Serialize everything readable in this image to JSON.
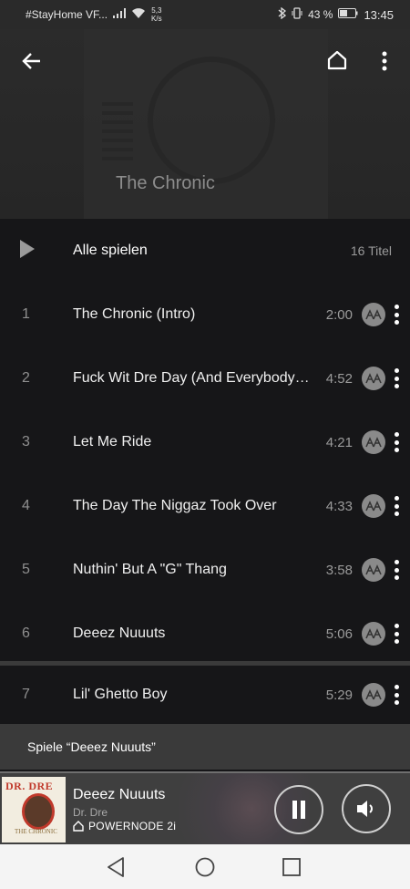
{
  "status_bar": {
    "carrier": "#StayHome VF...",
    "speed_value": "5,3",
    "speed_unit": "K/s",
    "battery": "43 %",
    "time": "13:45"
  },
  "header": {
    "album_title": "The Chronic",
    "icons": [
      "back-arrow-icon",
      "home-icon",
      "more-vert-icon"
    ]
  },
  "play_all": {
    "label": "Alle spielen",
    "count": "16 Titel"
  },
  "tracks": [
    {
      "num": "1",
      "title": "The Chronic (Intro)",
      "duration": "2:00"
    },
    {
      "num": "2",
      "title": "Fuck Wit Dre Day (And Everybody's...",
      "duration": "4:52"
    },
    {
      "num": "3",
      "title": "Let Me Ride",
      "duration": "4:21"
    },
    {
      "num": "4",
      "title": "The Day The Niggaz Took Over",
      "duration": "4:33"
    },
    {
      "num": "5",
      "title": "Nuthin' But A \"G\" Thang",
      "duration": "3:58"
    },
    {
      "num": "6",
      "title": "Deeez Nuuuts",
      "duration": "5:06"
    },
    {
      "num": "7",
      "title": "Lil' Ghetto Boy",
      "duration": "5:29"
    }
  ],
  "toast": {
    "text": "Spiele “Deeez Nuuuts”"
  },
  "now_playing": {
    "title": "Deeez Nuuuts",
    "artist": "Dr. Dre",
    "device": "POWERNODE 2i",
    "art_logo": "DR. DRE",
    "art_subtitle": "THE CHRONIC",
    "icons": [
      "pause-icon",
      "volume-icon"
    ]
  },
  "colors": {
    "background": "#161618",
    "toast": "#3a3a3a",
    "now_playing_bar": "#3f3f3f",
    "nav_bar": "#f4f4f4"
  }
}
